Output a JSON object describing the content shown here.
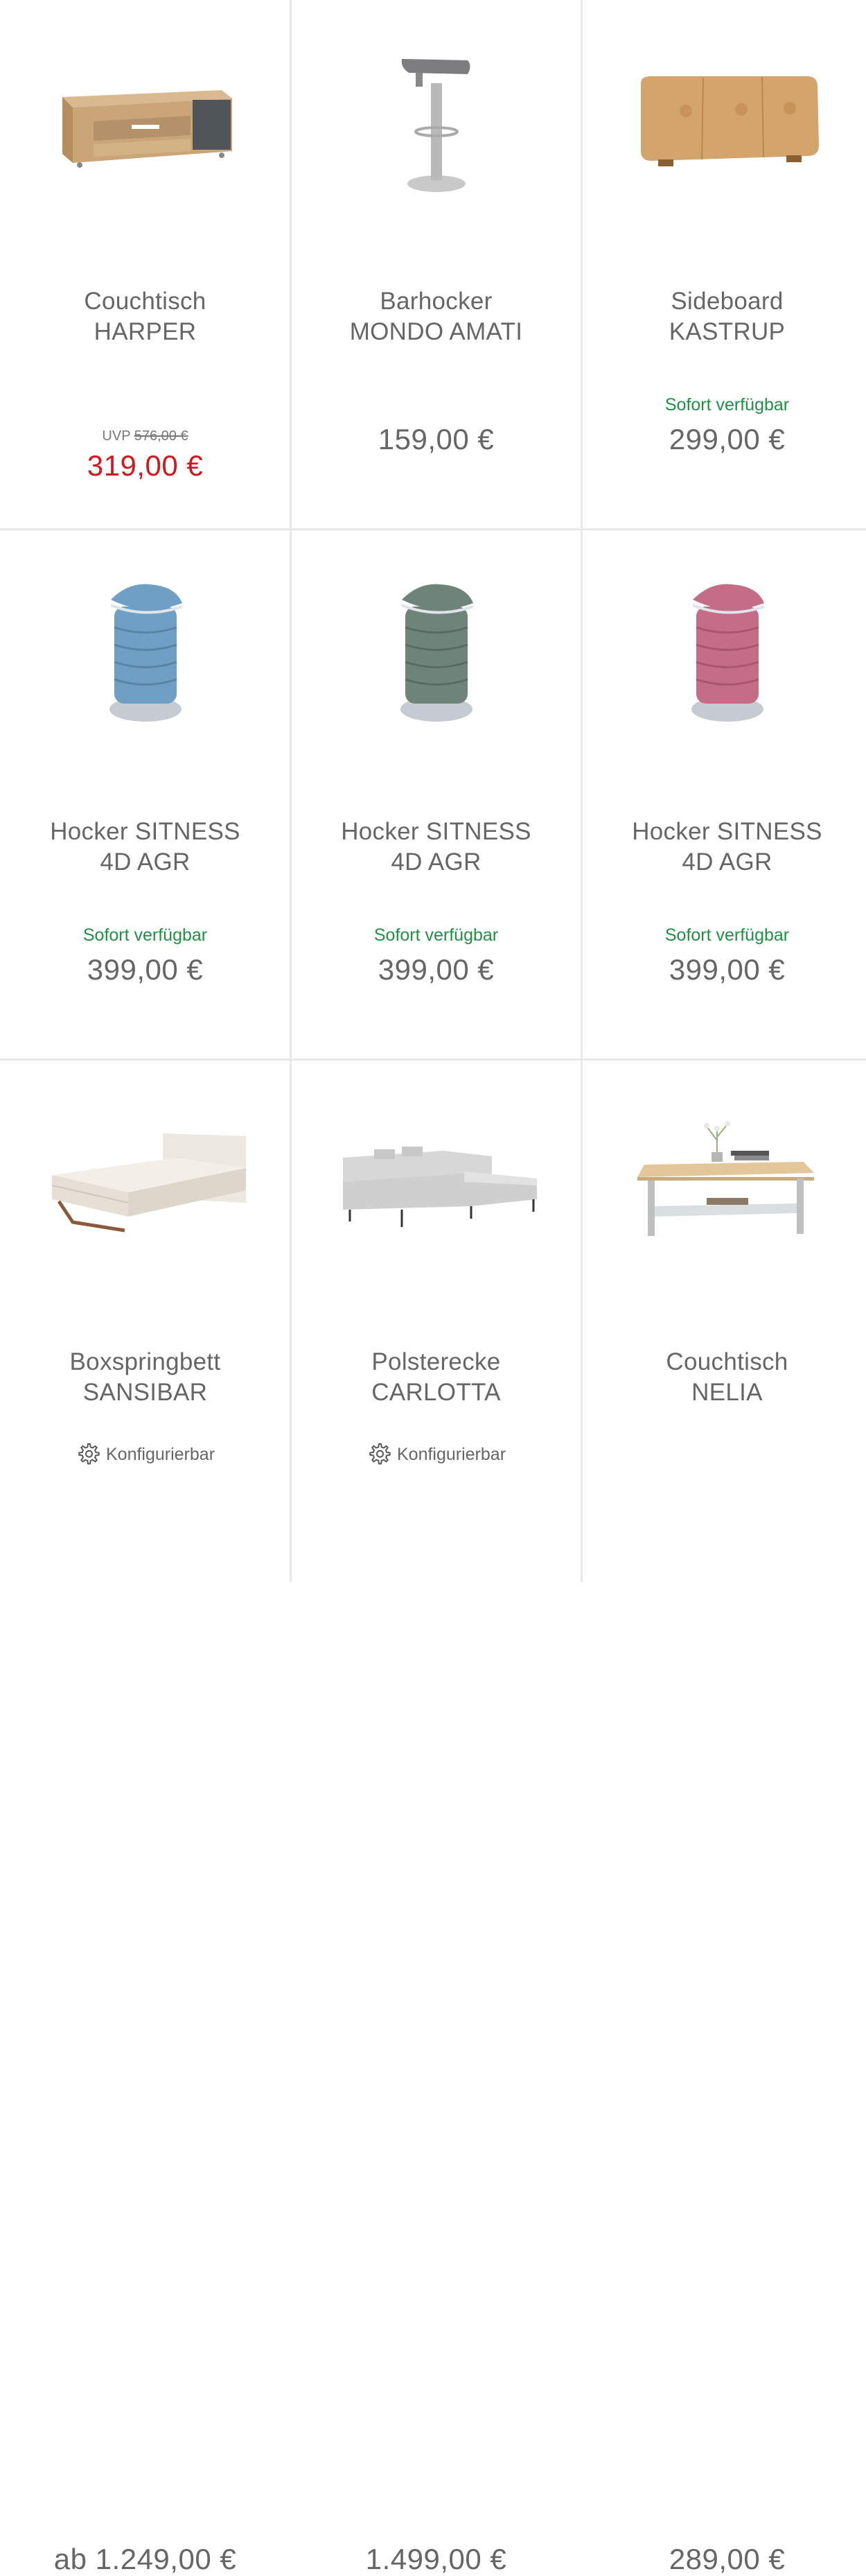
{
  "products": [
    {
      "name_line1": "Couchtisch",
      "name_line2": "HARPER",
      "uvp_label": "UVP",
      "uvp_price": "576,00 €",
      "price": "319,00 €",
      "icon": "coffee-table-tv-unit"
    },
    {
      "name_line1": "Barhocker",
      "name_line2": "MONDO AMATI",
      "price": "159,00 €",
      "icon": "bar-stool"
    },
    {
      "name_line1": "Sideboard",
      "name_line2": "KASTRUP",
      "availability": "Sofort verfügbar",
      "price": "299,00 €",
      "icon": "sideboard"
    },
    {
      "name_line1": "Hocker SITNESS",
      "name_line2": "4D AGR",
      "availability": "Sofort verfügbar",
      "price": "399,00 €",
      "icon": "stool-blue",
      "color": "#6f9fc4"
    },
    {
      "name_line1": "Hocker SITNESS",
      "name_line2": "4D AGR",
      "availability": "Sofort verfügbar",
      "price": "399,00 €",
      "icon": "stool-green",
      "color": "#6f8479"
    },
    {
      "name_line1": "Hocker SITNESS",
      "name_line2": "4D AGR",
      "availability": "Sofort verfügbar",
      "price": "399,00 €",
      "icon": "stool-pink",
      "color": "#c56c86"
    },
    {
      "name_line1": "Boxspringbett",
      "name_line2": "SANSIBAR",
      "configurable": "Konfigurierbar",
      "price": "ab 1.249,00 €",
      "icon": "bed"
    },
    {
      "name_line1": "Polsterecke",
      "name_line2": "CARLOTTA",
      "configurable": "Konfigurierbar",
      "price": "1.499,00 €",
      "icon": "corner-sofa"
    },
    {
      "name_line1": "Couchtisch",
      "name_line2": "NELIA",
      "price": "289,00 €",
      "icon": "coffee-table"
    }
  ],
  "colors": {
    "availability": "#1f9145",
    "sale_price": "#d0181f",
    "divider": "#e6e8ea"
  }
}
